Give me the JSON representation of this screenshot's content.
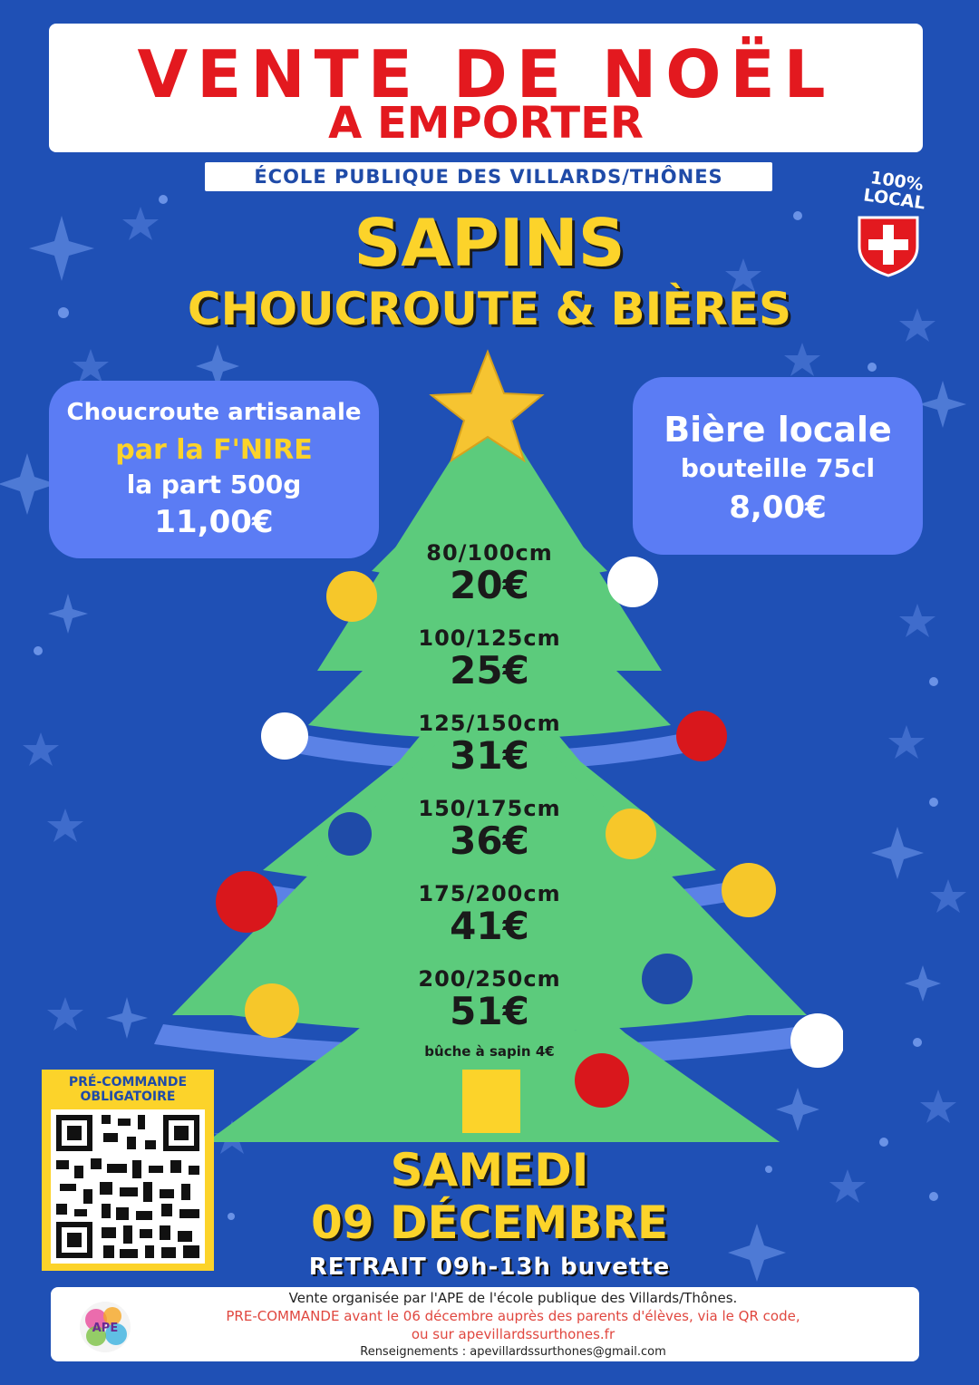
{
  "header": {
    "title_line1": "VENTE DE NOËL",
    "title_line2": "A EMPORTER",
    "school": "ÉCOLE PUBLIQUE  DES VILLARDS/THÔNES",
    "local_badge": [
      "100%",
      "LOCAL"
    ]
  },
  "headline": {
    "line1": "SAPINS",
    "line2": "CHOUCROUTE & BIÈRES"
  },
  "choucroute": {
    "line1": "Choucroute artisanale",
    "line2": "par la F'NIRE",
    "line3": "la part 500g",
    "price": "11,00€"
  },
  "biere": {
    "line1": "Bière locale",
    "line2": "bouteille 75cl",
    "price": "8,00€"
  },
  "sapins_prices": [
    {
      "size": "80/100cm",
      "price": "20€"
    },
    {
      "size": "100/125cm",
      "price": "25€"
    },
    {
      "size": "125/150cm",
      "price": "31€"
    },
    {
      "size": "150/175cm",
      "price": "36€"
    },
    {
      "size": "175/200cm",
      "price": "41€"
    },
    {
      "size": "200/250cm",
      "price": "51€"
    }
  ],
  "buche_note": "bûche à sapin 4€",
  "qr": {
    "label_line1": "PRÉ-COMMANDE",
    "label_line2": "OBLIGATOIRE"
  },
  "event": {
    "day": "SAMEDI",
    "date": "09 DÉCEMBRE",
    "retrait": "RETRAIT 09h-13h buvette"
  },
  "footer": {
    "line1": "Vente organisée par l'APE de l'école publique des Villards/Thônes.",
    "line2": "PRE-COMMANDE avant le 06 décembre auprès des parents d'élèves, via le QR code,",
    "line3": "ou sur apevillardssurthones.fr",
    "line4": "Renseignements : apevillardssurthones@gmail.com",
    "logo_text": "APE"
  },
  "colors": {
    "background": "#1f50b5",
    "title_red": "#e3191f",
    "yellow": "#fcd32a",
    "tree_green": "#5ccb7c",
    "bubble_blue": "#5b7cf4"
  }
}
